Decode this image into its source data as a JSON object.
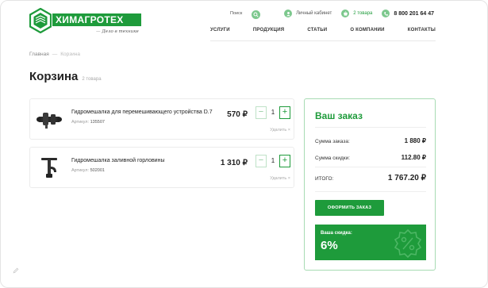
{
  "header": {
    "logo_text": "ХИМАГРОТЕХ",
    "logo_tagline": "— Дело в технике",
    "search_label": "Поиск",
    "account_label": "Личный кабинет",
    "basket_label": "2 товара",
    "phone": "8 800 201 64 47"
  },
  "nav": [
    "УСЛУГИ",
    "ПРОДУКЦИЯ",
    "СТАТЬИ",
    "О КОМПАНИИ",
    "КОНТАКТЫ"
  ],
  "breadcrumbs": {
    "home": "Главная",
    "separator": "—",
    "current": "Корзина"
  },
  "page": {
    "title": "Корзина",
    "count": "2 товара"
  },
  "cart": {
    "items": [
      {
        "name": "Гидромешалка для перемешивающего устройства D.7",
        "sku_label": "Артикул:",
        "sku": "135507",
        "price": "570 ₽",
        "qty": "1",
        "remove": "Удалить ×"
      },
      {
        "name": "Гидромешалка заливной горловины",
        "sku_label": "Артикул:",
        "sku": "502001",
        "price": "1 310 ₽",
        "qty": "1",
        "remove": "Удалить ×"
      }
    ],
    "minus": "−",
    "plus": "+"
  },
  "order": {
    "title": "Ваш заказ",
    "sum_label": "Сумма заказа:",
    "sum_value": "1 880 ₽",
    "discount_label": "Сумма скидки:",
    "discount_value": "112.80 ₽",
    "total_label": "ИТОГО:",
    "total_value": "1 767.20 ₽",
    "checkout": "ОФОРМИТЬ ЗАКАЗ",
    "your_discount_label": "Ваша скидка:",
    "your_discount_value": "6%"
  },
  "colors": {
    "brand": "#1e9b3b",
    "brand_light": "#7cc88d"
  }
}
